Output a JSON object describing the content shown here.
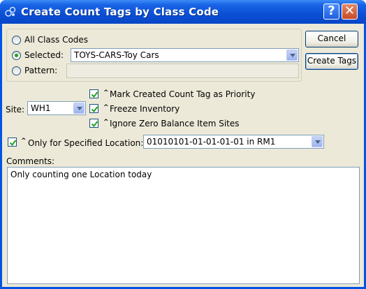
{
  "window": {
    "title": "Create Count Tags by Class Code"
  },
  "class_code": {
    "all_label": "All Class Codes",
    "selected_label": "Selected:",
    "selected_value": "TOYS-CARS-Toy Cars",
    "pattern_label": "Pattern:",
    "pattern_value": "",
    "selected_option": "Selected"
  },
  "buttons": {
    "cancel": "Cancel",
    "create": "Create Tags"
  },
  "site": {
    "label": "Site:",
    "value": "WH1"
  },
  "options": {
    "mark_priority": "Mark Created Count Tag as Priority",
    "freeze_inventory": "Freeze Inventory",
    "ignore_zero": "Ignore Zero Balance Item Sites",
    "caret": "^"
  },
  "location": {
    "label": "Only for Specified Location:",
    "value": "01010101-01-01-01-01 in RM1",
    "checked": true
  },
  "comments": {
    "label": "Comments:",
    "value": "Only counting one Location today"
  },
  "colors": {
    "title_bar": "#0a4fd4",
    "dialog_bg": "#ece9d8",
    "check_green": "#21a121"
  }
}
